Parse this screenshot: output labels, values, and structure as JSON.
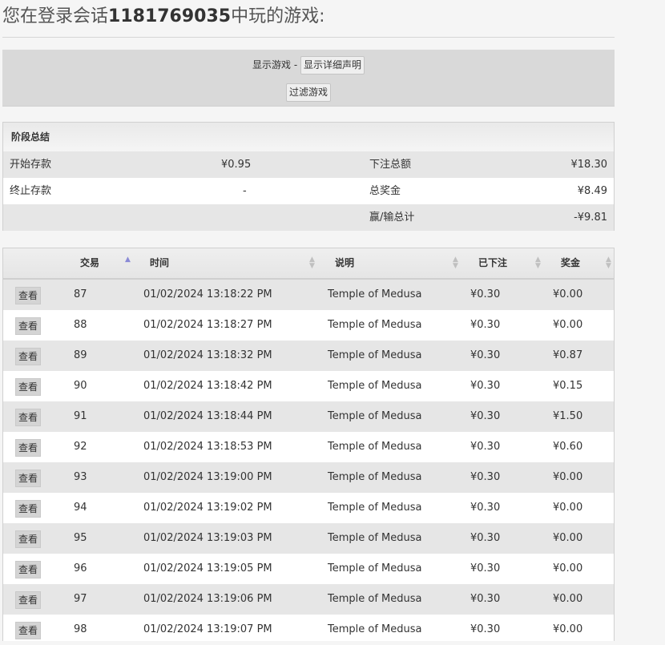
{
  "header": {
    "prefix": "您在登录会话",
    "session_id": "1181769035",
    "suffix": "中玩的游戏:"
  },
  "controls": {
    "label": "显示游戏 - ",
    "details_button": "显示详细声明",
    "filter_button": "过滤游戏"
  },
  "summary": {
    "title": "阶段总结",
    "rows": [
      {
        "left_label": "开始存款",
        "left_value": "¥0.95",
        "right_label": "下注总额",
        "right_value": "¥18.30"
      },
      {
        "left_label": "终止存款",
        "left_value": "-",
        "right_label": "总奖金",
        "right_value": "¥8.49"
      },
      {
        "left_label": "",
        "left_value": "",
        "right_label": "赢/输总计",
        "right_value": "-¥9.81"
      }
    ]
  },
  "table": {
    "columns": [
      "交易",
      "时间",
      "说明",
      "已下注",
      "奖金"
    ],
    "view_label": "查看",
    "rows": [
      {
        "id": "87",
        "time": "01/02/2024 13:18:22 PM",
        "desc": "Temple of Medusa",
        "bet": "¥0.30",
        "win": "¥0.00"
      },
      {
        "id": "88",
        "time": "01/02/2024 13:18:27 PM",
        "desc": "Temple of Medusa",
        "bet": "¥0.30",
        "win": "¥0.00"
      },
      {
        "id": "89",
        "time": "01/02/2024 13:18:32 PM",
        "desc": "Temple of Medusa",
        "bet": "¥0.30",
        "win": "¥0.87"
      },
      {
        "id": "90",
        "time": "01/02/2024 13:18:42 PM",
        "desc": "Temple of Medusa",
        "bet": "¥0.30",
        "win": "¥0.15"
      },
      {
        "id": "91",
        "time": "01/02/2024 13:18:44 PM",
        "desc": "Temple of Medusa",
        "bet": "¥0.30",
        "win": "¥1.50"
      },
      {
        "id": "92",
        "time": "01/02/2024 13:18:53 PM",
        "desc": "Temple of Medusa",
        "bet": "¥0.30",
        "win": "¥0.60"
      },
      {
        "id": "93",
        "time": "01/02/2024 13:19:00 PM",
        "desc": "Temple of Medusa",
        "bet": "¥0.30",
        "win": "¥0.00"
      },
      {
        "id": "94",
        "time": "01/02/2024 13:19:02 PM",
        "desc": "Temple of Medusa",
        "bet": "¥0.30",
        "win": "¥0.00"
      },
      {
        "id": "95",
        "time": "01/02/2024 13:19:03 PM",
        "desc": "Temple of Medusa",
        "bet": "¥0.30",
        "win": "¥0.00"
      },
      {
        "id": "96",
        "time": "01/02/2024 13:19:05 PM",
        "desc": "Temple of Medusa",
        "bet": "¥0.30",
        "win": "¥0.00"
      },
      {
        "id": "97",
        "time": "01/02/2024 13:19:06 PM",
        "desc": "Temple of Medusa",
        "bet": "¥0.30",
        "win": "¥0.00"
      },
      {
        "id": "98",
        "time": "01/02/2024 13:19:07 PM",
        "desc": "Temple of Medusa",
        "bet": "¥0.30",
        "win": "¥0.00"
      }
    ]
  }
}
